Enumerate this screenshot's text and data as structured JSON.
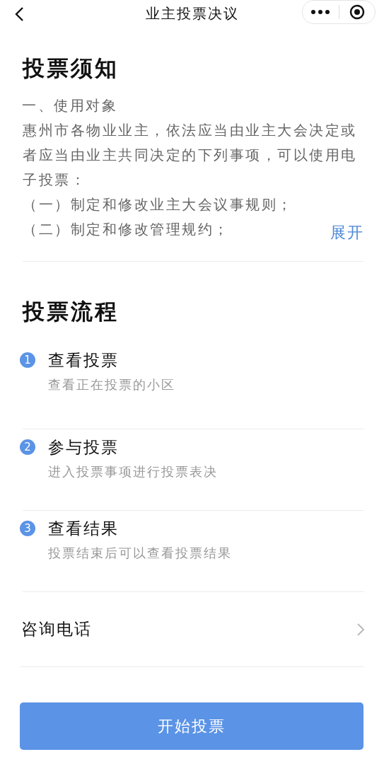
{
  "nav": {
    "title": "业主投票决议"
  },
  "notice": {
    "title": "投票须知",
    "lines": [
      "一、使用对象",
      "惠州市各物业业主，依法应当由业主大会决定或",
      "者应当由业主共同决定的下列事项，可以使用电",
      "子投票：",
      "（一）制定和修改业主大会议事规则；",
      "（二）制定和修改管理规约；"
    ],
    "expand": "展开"
  },
  "process": {
    "title": "投票流程",
    "steps": [
      {
        "number": "1",
        "title": "查看投票",
        "subtitle": "查看正在投票的小区"
      },
      {
        "number": "2",
        "title": "参与投票",
        "subtitle": "进入投票事项进行投票表决"
      },
      {
        "number": "3",
        "title": "查看结果",
        "subtitle": "投票结束后可以查看投票结果"
      }
    ]
  },
  "contact": {
    "label": "咨询电话"
  },
  "button": {
    "label": "开始投票"
  }
}
